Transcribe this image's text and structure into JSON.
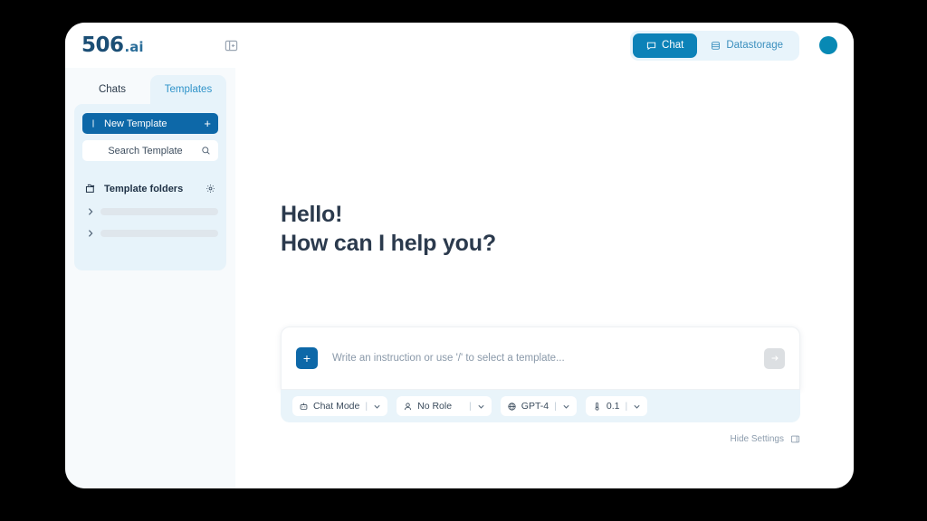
{
  "brand": {
    "logo_mark": "506",
    "logo_suffix": ".ai"
  },
  "header": {
    "sidebar_toggle_icon": "panel-toggle-icon",
    "modes": [
      {
        "label": "Chat",
        "icon": "chat-bubble-icon",
        "active": true
      },
      {
        "label": "Datastorage",
        "icon": "database-icon",
        "active": false
      }
    ],
    "avatar_color": "#0889b4"
  },
  "sidebar": {
    "tabs": [
      {
        "label": "Chats",
        "active": false
      },
      {
        "label": "Templates",
        "active": true
      }
    ],
    "new_template": {
      "label": "New Template",
      "plus": "+",
      "icon": "note-icon"
    },
    "search": {
      "label": "Search Template",
      "icon": "search-icon"
    },
    "folders_section": {
      "label": "Template folders",
      "folder_icon": "folders-icon",
      "settings_icon": "gear-icon",
      "items": [
        {
          "chevron": "chevron-right-icon"
        },
        {
          "chevron": "chevron-right-icon"
        }
      ]
    }
  },
  "main": {
    "greeting_line1": "Hello!",
    "greeting_line2": "How can I help you?",
    "composer": {
      "attach_label": "+",
      "placeholder": "Write an instruction or use '/' to select a template...",
      "value": "",
      "send_icon": "arrow-right-icon"
    },
    "settings": [
      {
        "label": "Chat Mode",
        "icon": "robot-icon"
      },
      {
        "label": "No Role",
        "icon": "person-icon"
      },
      {
        "label": "GPT-4",
        "icon": "globe-icon"
      },
      {
        "label": "0.1",
        "icon": "thermometer-icon"
      }
    ],
    "hide_settings": {
      "label": "Hide Settings",
      "icon": "panel-collapse-icon"
    }
  },
  "colors": {
    "accent": "#0c82b8",
    "accent_dark": "#0d68a8",
    "panel_blue": "#e7f3fa",
    "text_dark": "#2b3a4d"
  }
}
